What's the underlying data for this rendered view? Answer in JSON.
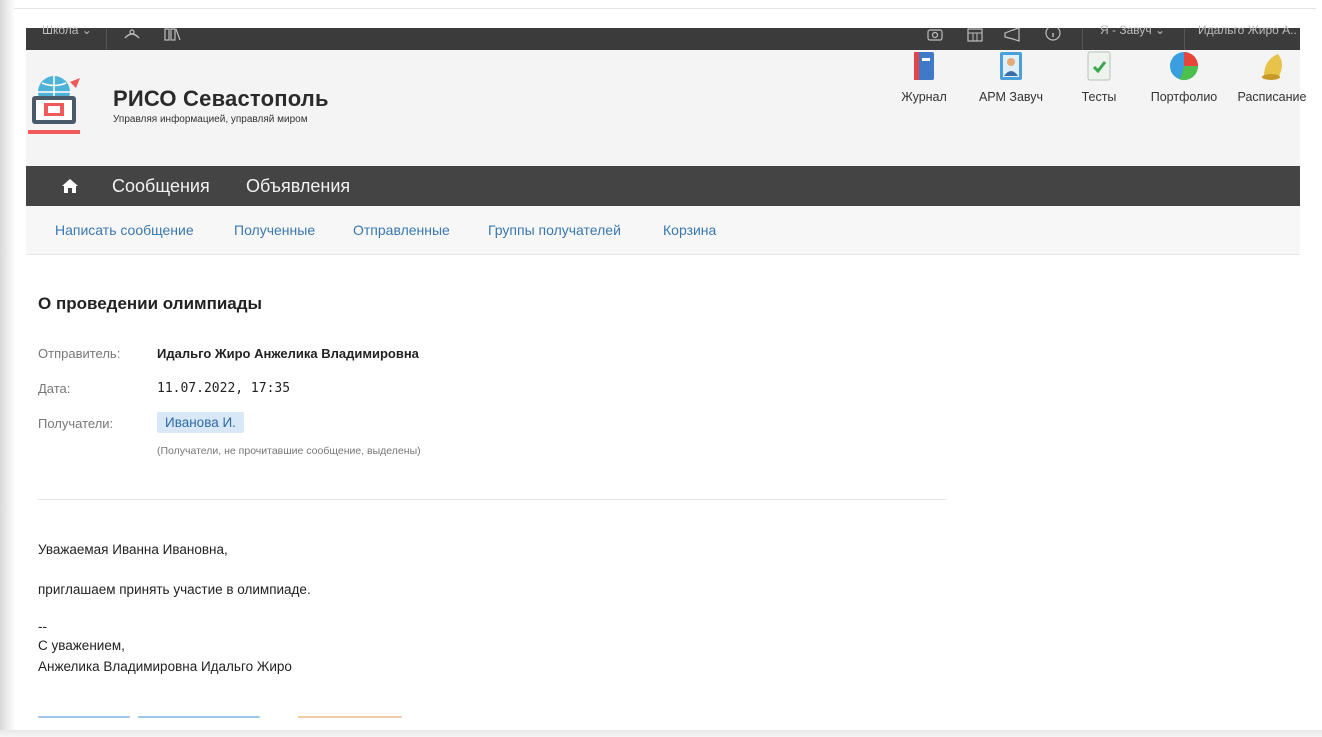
{
  "topbar": {
    "school_label": "Школа ⌄",
    "role_label": "Я - Завуч ⌄",
    "user_label": "Идальго Жиро А..."
  },
  "brand": {
    "title": "РИСО Севастополь",
    "subtitle": "Управляя информацией, управляй миром"
  },
  "apps": [
    {
      "label": "Журнал",
      "icon": "journal-icon"
    },
    {
      "label": "АРМ Завуч",
      "icon": "deputy-workstation-icon"
    },
    {
      "label": "Тесты",
      "icon": "tests-icon"
    },
    {
      "label": "Портфолио",
      "icon": "portfolio-icon"
    },
    {
      "label": "Расписание",
      "icon": "schedule-bell-icon"
    }
  ],
  "nav": {
    "home_icon": "home-icon",
    "items": [
      "Сообщения",
      "Объявления"
    ]
  },
  "subnav": {
    "items": [
      "Написать сообщение",
      "Полученные",
      "Отправленные",
      "Группы получателей",
      "Корзина"
    ]
  },
  "message": {
    "title": "О проведении олимпиады",
    "sender_label": "Отправитель:",
    "sender": "Идальго Жиро Анжелика Владимировна",
    "date_label": "Дата:",
    "date": "11.07.2022, 17:35",
    "recipients_label": "Получатели:",
    "recipients": [
      "Иванова И."
    ],
    "recipients_hint": "(Получатели, не прочитавшие сообщение, выделены)",
    "body": [
      "Уважаемая Иванна Ивановна,",
      "приглашаем принять участие в олимпиаде.",
      "--",
      "С уважением,",
      "Анжелика Владимировна Идальго Жиро"
    ]
  },
  "colors": {
    "topbar": "#3b3b3b",
    "nav": "#444444",
    "link": "#3a78b0",
    "tag_bg": "#d9e8f6"
  }
}
